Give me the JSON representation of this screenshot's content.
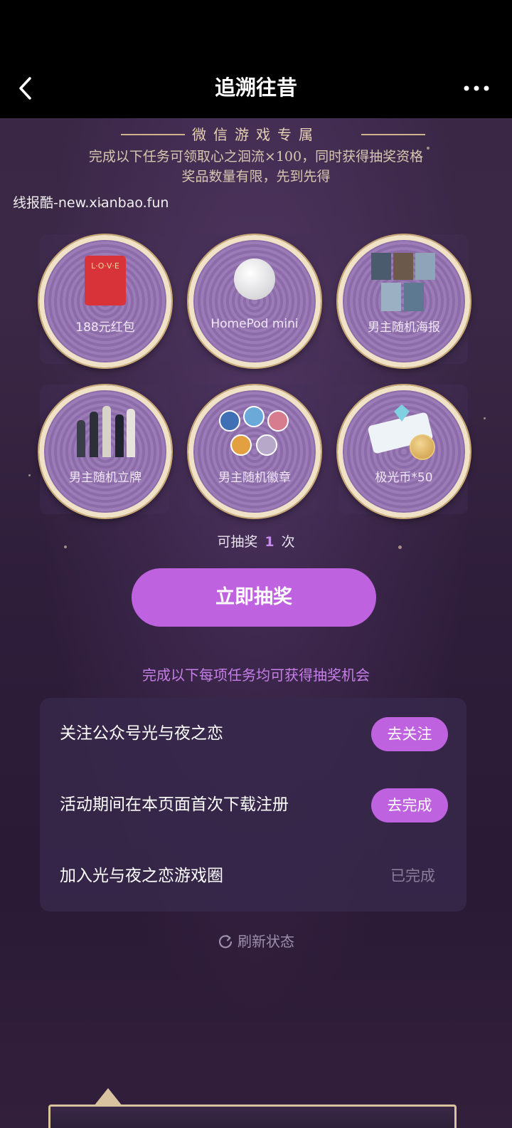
{
  "nav": {
    "title": "追溯往昔",
    "back_icon": "chevron-left-icon",
    "more_icon": "more-dots-icon"
  },
  "banner": {
    "title": "微信游戏专属",
    "subtitle_line1": "完成以下任务可领取心之洄流×100，同时获得抽奖资格",
    "subtitle_line2": "奖品数量有限，先到先得"
  },
  "watermark": "线报酷-new.xianbao.fun",
  "prizes": [
    {
      "label": "188元红包",
      "icon": "red-envelope-icon"
    },
    {
      "label": "HomePod mini",
      "icon": "speaker-icon"
    },
    {
      "label": "男主随机海报",
      "icon": "poster-icon"
    },
    {
      "label": "男主随机立牌",
      "icon": "standee-icon"
    },
    {
      "label": "男主随机徽章",
      "icon": "badge-icon"
    },
    {
      "label": "极光币*50",
      "icon": "coin-icon"
    }
  ],
  "draw": {
    "prefix": "可抽奖",
    "count": "1",
    "suffix": "次",
    "button_label": "立即抽奖"
  },
  "tasks": {
    "hint": "完成以下每项任务均可获得抽奖机会",
    "items": [
      {
        "label": "关注公众号光与夜之恋",
        "action": "去关注",
        "done": false
      },
      {
        "label": "活动期间在本页面首次下载注册",
        "action": "去完成",
        "done": false
      },
      {
        "label": "加入光与夜之恋游戏圈",
        "action": "已完成",
        "done": true
      }
    ]
  },
  "refresh": {
    "label": "刷新状态",
    "icon": "refresh-icon"
  },
  "colors": {
    "accent": "#bf62e0",
    "hint_text": "#c67ee8",
    "done_text": "#8a7d99"
  }
}
